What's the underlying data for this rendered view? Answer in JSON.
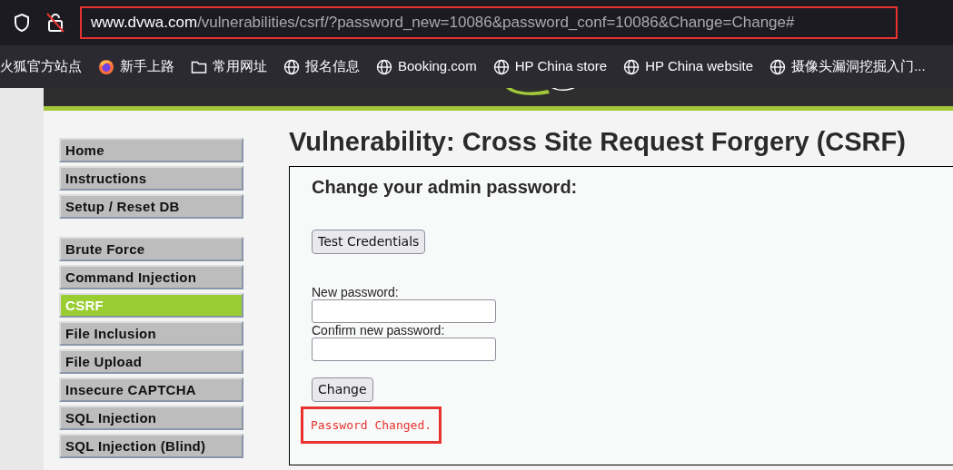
{
  "browser": {
    "url_host": "www.dvwa.com",
    "url_rest": "/vulnerabilities/csrf/?password_new=10086&password_conf=10086&Change=Change#",
    "highlighted": true
  },
  "bookmarks": [
    {
      "label": "火狐官方站点",
      "kind": "plain"
    },
    {
      "label": "新手上路",
      "kind": "firefox"
    },
    {
      "label": "常用网址",
      "kind": "folder"
    },
    {
      "label": "报名信息",
      "kind": "site"
    },
    {
      "label": "Booking.com",
      "kind": "site"
    },
    {
      "label": "HP China store",
      "kind": "site"
    },
    {
      "label": "HP China website",
      "kind": "site"
    },
    {
      "label": "摄像头漏洞挖掘入门...",
      "kind": "site"
    }
  ],
  "menu_groups": [
    [
      {
        "label": "Home",
        "selected": false
      },
      {
        "label": "Instructions",
        "selected": false
      },
      {
        "label": "Setup / Reset DB",
        "selected": false
      }
    ],
    [
      {
        "label": "Brute Force",
        "selected": false
      },
      {
        "label": "Command Injection",
        "selected": false
      },
      {
        "label": "CSRF",
        "selected": true
      },
      {
        "label": "File Inclusion",
        "selected": false
      },
      {
        "label": "File Upload",
        "selected": false
      },
      {
        "label": "Insecure CAPTCHA",
        "selected": false
      },
      {
        "label": "SQL Injection",
        "selected": false
      },
      {
        "label": "SQL Injection (Blind)",
        "selected": false
      }
    ]
  ],
  "page_title": "Vulnerability: Cross Site Request Forgery (CSRF)",
  "form": {
    "title": "Change your admin password:",
    "test_button": "Test Credentials",
    "fields": [
      {
        "label": "New password:"
      },
      {
        "label": "Confirm new password:"
      }
    ],
    "submit_button": "Change",
    "message": "Password Changed.",
    "message_highlighted": true
  }
}
